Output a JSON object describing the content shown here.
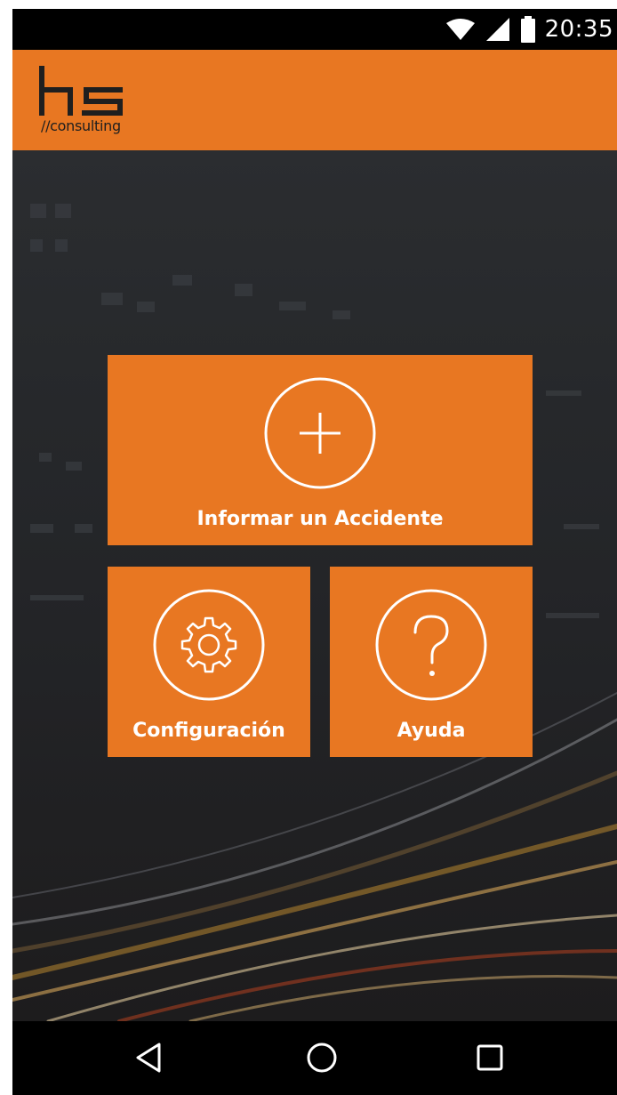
{
  "status_bar": {
    "time": "20:35",
    "icons": [
      "wifi-icon",
      "signal-icon",
      "battery-icon"
    ]
  },
  "app_bar": {
    "logo_text": "hs",
    "logo_subtext": "//consulting",
    "color": "#e87722"
  },
  "tiles": {
    "report": {
      "label": "Informar un Accidente",
      "icon": "plus-circle-icon"
    },
    "settings": {
      "label": "Configuración",
      "icon": "gear-icon"
    },
    "help": {
      "label": "Ayuda",
      "icon": "question-icon"
    }
  },
  "nav_bar": {
    "buttons": [
      "back-icon",
      "home-icon",
      "recents-icon"
    ]
  },
  "colors": {
    "accent": "#e87722",
    "background": "#232427"
  }
}
